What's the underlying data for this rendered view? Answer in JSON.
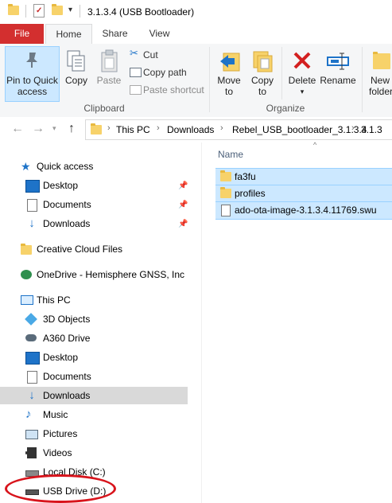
{
  "window": {
    "title": "3.1.3.4 (USB Bootloader)"
  },
  "ribbon_tabs": [
    "File",
    "Home",
    "Share",
    "View"
  ],
  "ribbon": {
    "pin_label_1": "Pin to Quick",
    "pin_label_2": "access",
    "copy": "Copy",
    "paste": "Paste",
    "cut": "Cut",
    "copy_path": "Copy path",
    "paste_shortcut": "Paste shortcut",
    "clipboard_group": "Clipboard",
    "move_to": "Move",
    "move_to_2": "to",
    "copy_to": "Copy",
    "copy_to_2": "to",
    "delete": "Delete",
    "rename": "Rename",
    "organize_group": "Organize",
    "new_folder_1": "New",
    "new_folder_2": "folder"
  },
  "address": {
    "crumbs": [
      "This PC",
      "Downloads",
      "Rebel_USB_bootloader_3.1.3.4",
      "3.1.3"
    ]
  },
  "nav": {
    "quick_access": "Quick access",
    "qa_desktop": "Desktop",
    "qa_documents": "Documents",
    "qa_downloads": "Downloads",
    "creative_cloud": "Creative Cloud Files",
    "onedrive": "OneDrive - Hemisphere GNSS, Inc",
    "this_pc": "This PC",
    "objects3d": "3D Objects",
    "a360": "A360 Drive",
    "desktop": "Desktop",
    "documents": "Documents",
    "downloads": "Downloads",
    "music": "Music",
    "pictures": "Pictures",
    "videos": "Videos",
    "local_disk": "Local Disk (C:)",
    "usb_drive": "USB Drive (D:)"
  },
  "files": {
    "column_name": "Name",
    "items": [
      "fa3fu",
      "profiles",
      "ado-ota-image-3.1.3.4.11769.swu"
    ]
  }
}
